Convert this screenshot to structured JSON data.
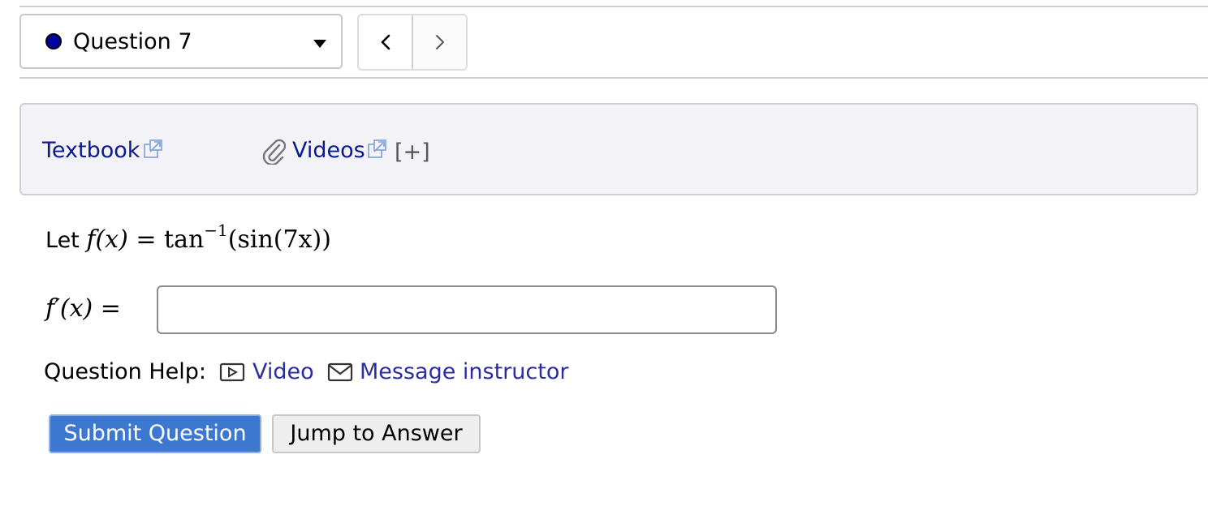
{
  "navigation": {
    "question_label": "Question 7",
    "status_color": "#0000a0",
    "prev_icon": "chevron-left-icon",
    "next_icon": "chevron-right-icon"
  },
  "resources": {
    "textbook_label": "Textbook",
    "videos_label": "Videos",
    "expand_label": "[+]",
    "link_color": "#0b1a8f",
    "background": "#f2f2f7"
  },
  "question": {
    "prompt_prefix": "Let",
    "function_lhs": "f(x)",
    "equals": "=",
    "function_rhs_fn": "tan",
    "function_rhs_sup": "−1",
    "function_rhs_arg": "(sin(7x))",
    "answer_label": "f′(x) =",
    "answer_value": "",
    "answer_placeholder": ""
  },
  "help": {
    "label": "Question Help:",
    "video_label": "Video",
    "message_label": "Message instructor",
    "link_color": "#2b2ea0"
  },
  "actions": {
    "submit_label": "Submit Question",
    "jump_label": "Jump to Answer",
    "submit_color": "#3c78d0"
  }
}
